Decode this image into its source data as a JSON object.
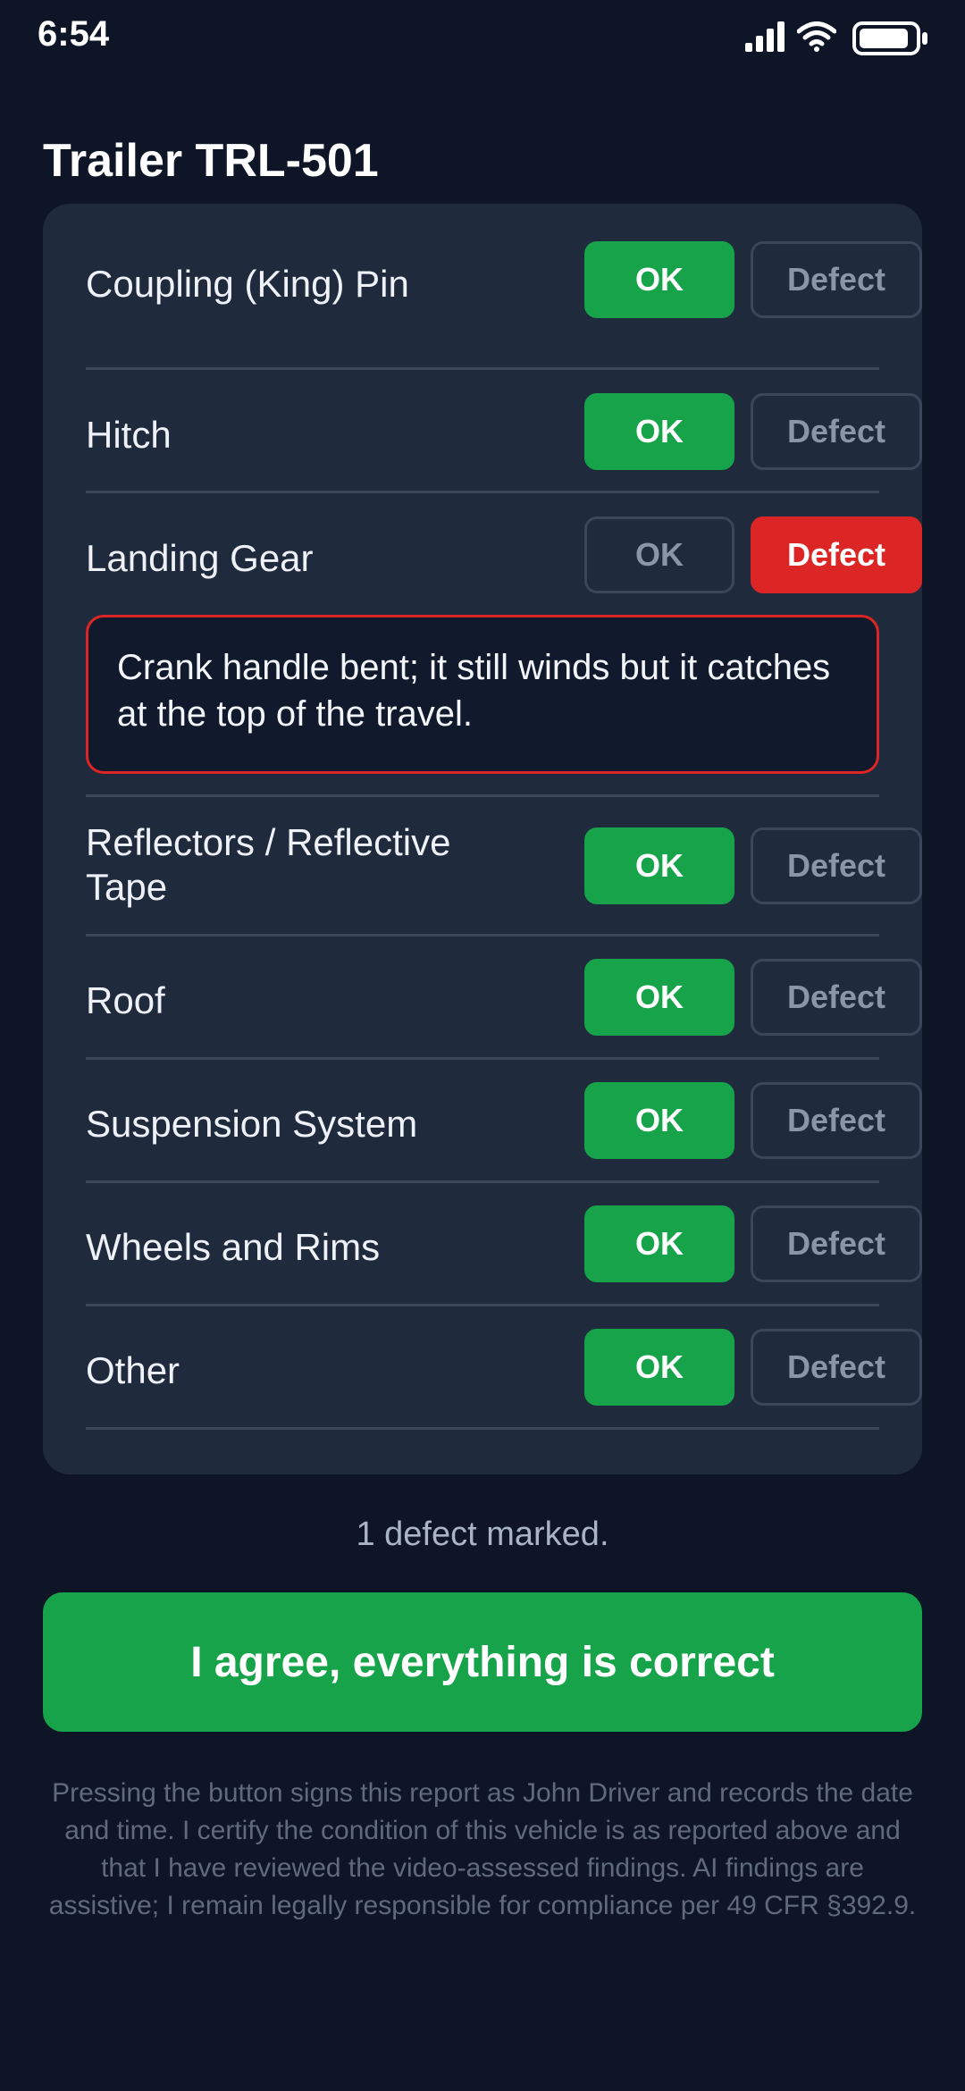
{
  "status_bar": {
    "time": "6:54",
    "icons": [
      "cellular-signal-icon",
      "wifi-icon",
      "battery-icon"
    ]
  },
  "page": {
    "title": "Trailer TRL-501"
  },
  "checklist": {
    "items": [
      {
        "label": "Coupling (King) Pin",
        "ok_label": "OK",
        "defect_label": "Defect",
        "status": "ok"
      },
      {
        "label": "Hitch",
        "ok_label": "OK",
        "defect_label": "Defect",
        "status": "ok"
      },
      {
        "label": "Landing Gear",
        "ok_label": "OK",
        "defect_label": "Defect",
        "status": "defect",
        "note": "Crank handle bent; it still winds but it catches at the top of the travel."
      },
      {
        "label": "Reflectors / Reflective Tape",
        "ok_label": "OK",
        "defect_label": "Defect",
        "status": "ok"
      },
      {
        "label": "Roof",
        "ok_label": "OK",
        "defect_label": "Defect",
        "status": "ok"
      },
      {
        "label": "Suspension System",
        "ok_label": "OK",
        "defect_label": "Defect",
        "status": "ok"
      },
      {
        "label": "Wheels and Rims",
        "ok_label": "OK",
        "defect_label": "Defect",
        "status": "ok"
      },
      {
        "label": "Other",
        "ok_label": "OK",
        "defect_label": "Defect",
        "status": "ok"
      }
    ]
  },
  "summary": {
    "text": "1 defect marked."
  },
  "agree_button": {
    "label": "I agree, everything is correct"
  },
  "disclaimer": {
    "text": "Pressing the button signs this report as John Driver and records the date and time. I certify the condition of this vehicle is as reported above and that I have reviewed the video-assessed findings. AI findings are assistive; I remain legally responsible for compliance per 49 CFR §392.9."
  },
  "colors": {
    "background": "#0d1526",
    "card": "#1f2a3c",
    "ok_green": "#16a34a",
    "defect_red": "#dc2626",
    "muted_text": "#8a96a8"
  }
}
